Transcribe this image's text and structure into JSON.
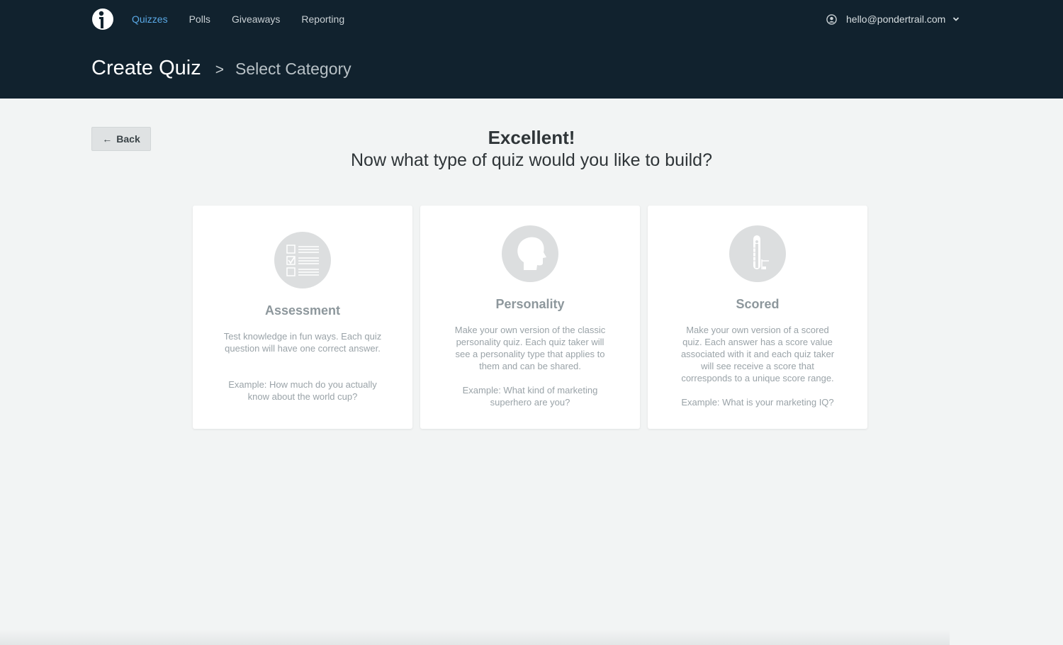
{
  "nav": {
    "items": [
      "Quizzes",
      "Polls",
      "Giveaways",
      "Reporting"
    ],
    "active_index": 0
  },
  "user": {
    "email": "hello@pondertrail.com"
  },
  "breadcrumb": {
    "title": "Create Quiz",
    "separator": ">",
    "sub": "Select Category"
  },
  "back_button": {
    "label": "Back"
  },
  "heading": {
    "line1": "Excellent!",
    "line2": "Now what type of quiz would you like to build?"
  },
  "cards": [
    {
      "title": "Assessment",
      "icon": "checklist-icon",
      "description": "Test knowledge in fun ways. Each quiz question will have one correct answer.",
      "example": "Example: How much do you actually know about the world cup?"
    },
    {
      "title": "Personality",
      "icon": "head-profile-icon",
      "description": "Make your own version of the classic personality quiz. Each quiz taker will see a personality type that applies to them and can be shared.",
      "example": "Example: What kind of marketing superhero are you?"
    },
    {
      "title": "Scored",
      "icon": "thermometer-icon",
      "description": "Make your own version of a scored quiz. Each answer has a score value associated with it and each quiz taker will see receive a score that corresponds to a unique score range.",
      "example": "Example: What is your marketing IQ?"
    }
  ],
  "colors": {
    "header_bg": "#11222e",
    "active_nav": "#5aa9e6",
    "page_bg": "#f2f4f4"
  }
}
